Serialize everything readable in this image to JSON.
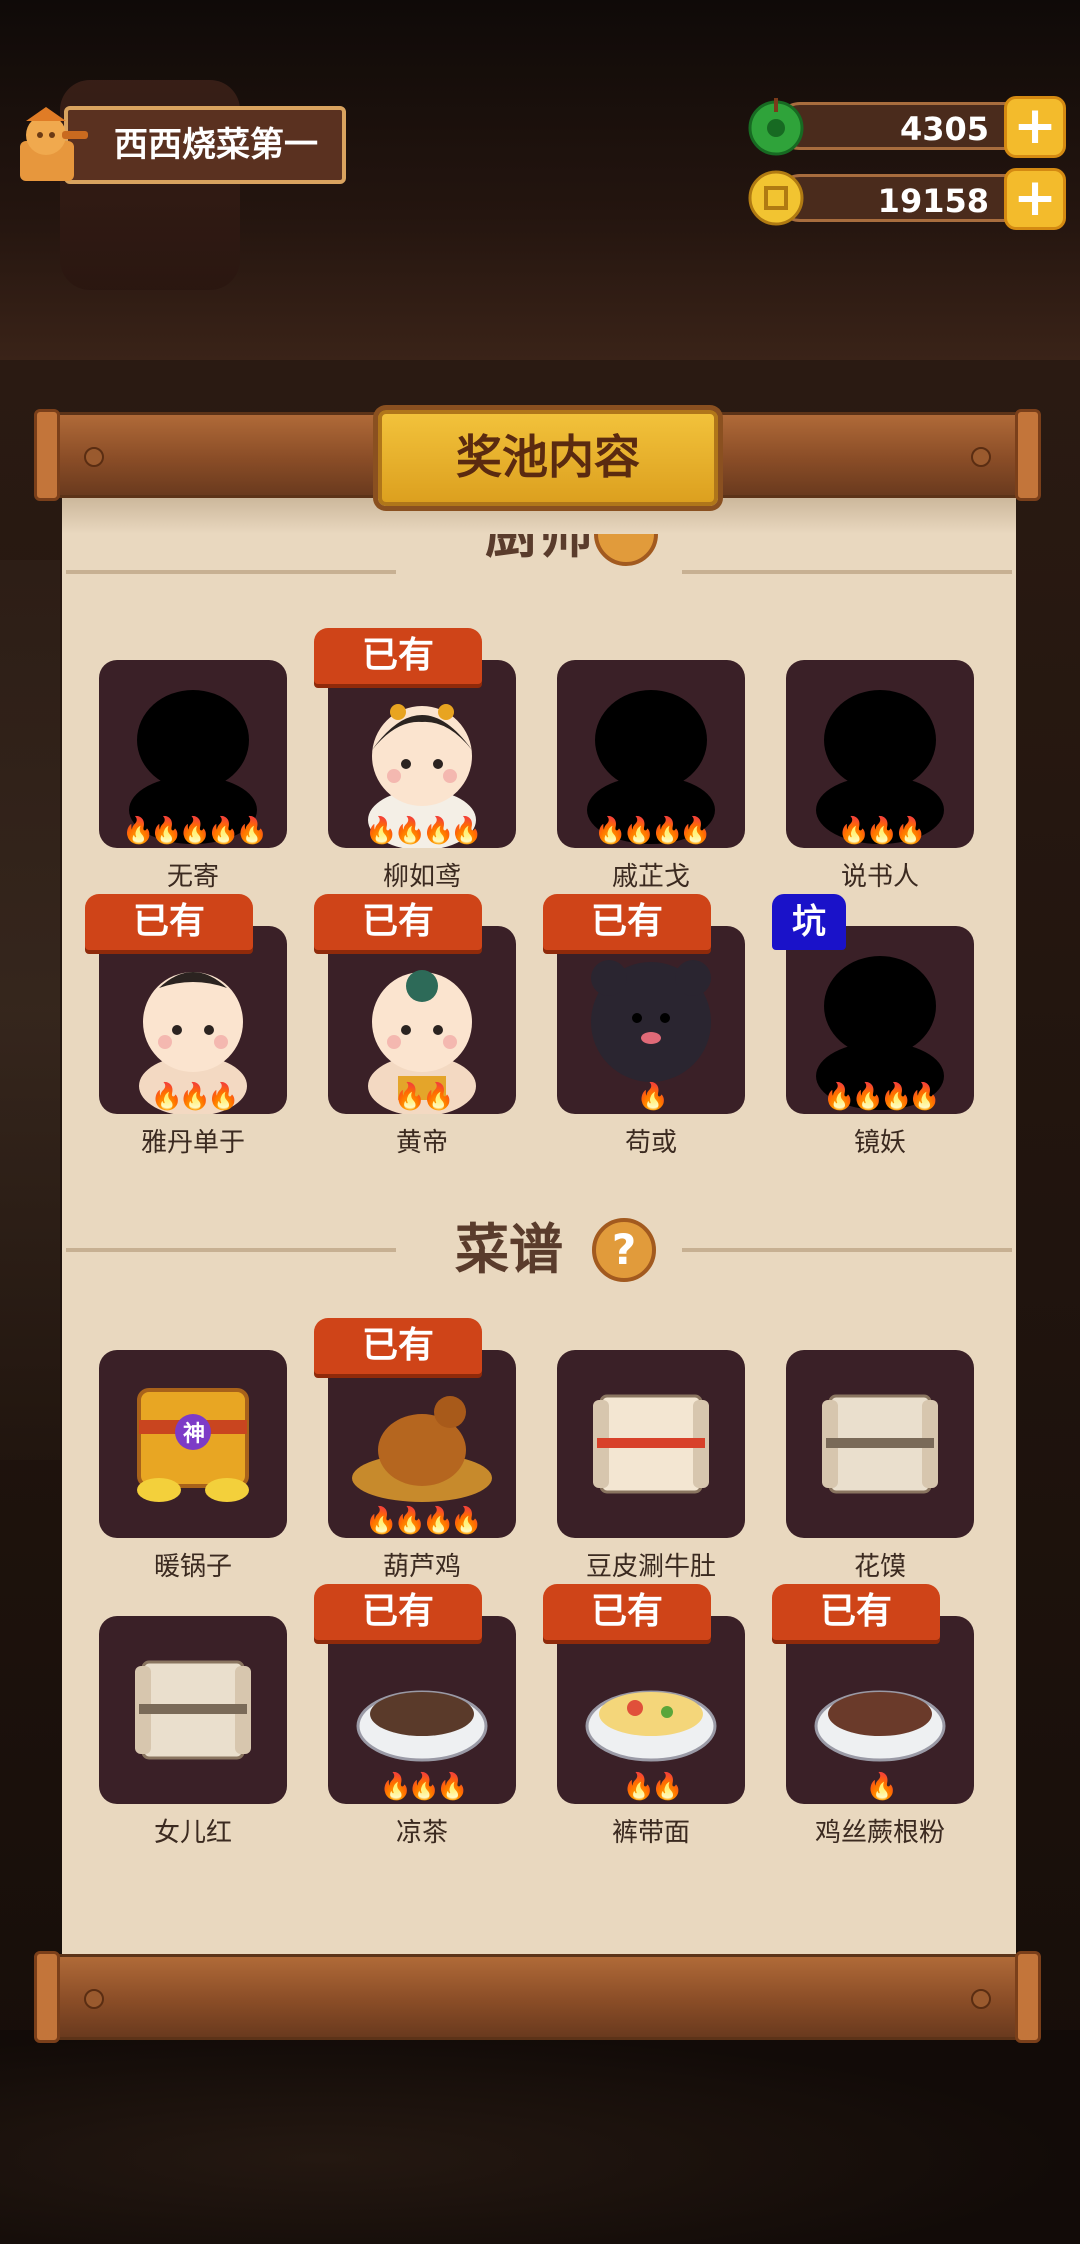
{
  "player": {
    "name": "西西烧菜第一",
    "avatar_icon": "chef-avatar-icon"
  },
  "currencies": [
    {
      "icon": "jade-coin-icon",
      "value": "4305"
    },
    {
      "icon": "copper-coin-icon",
      "value": "19158"
    }
  ],
  "panel": {
    "title": "奖池内容"
  },
  "sections": {
    "chefs": {
      "title": "厨师",
      "help": "?"
    },
    "recipes": {
      "title": "菜谱",
      "help": "?"
    }
  },
  "badges": {
    "owned": "已有",
    "pit": "坑"
  },
  "chefs": [
    {
      "name": "无寄",
      "fires": 5,
      "owned": false,
      "revealed": false
    },
    {
      "name": "柳如鸢",
      "fires": 4,
      "owned": true,
      "revealed": true
    },
    {
      "name": "戚芷戈",
      "fires": 4,
      "owned": false,
      "revealed": false
    },
    {
      "name": "说书人",
      "fires": 3,
      "owned": false,
      "revealed": false
    },
    {
      "name": "雅丹单于",
      "fires": 3,
      "owned": true,
      "revealed": true
    },
    {
      "name": "黄帝",
      "fires": 2,
      "owned": true,
      "revealed": true
    },
    {
      "name": "苟或",
      "fires": 1,
      "owned": true,
      "revealed": true
    },
    {
      "name": "镜妖",
      "fires": 4,
      "owned": false,
      "revealed": false,
      "pit": true
    }
  ],
  "recipes": [
    {
      "name": "暖锅子",
      "fires": 0,
      "owned": false,
      "icon": "golden-treasure-chest-icon",
      "tag": "神"
    },
    {
      "name": "葫芦鸡",
      "fires": 4,
      "owned": true,
      "icon": "roast-chicken-icon"
    },
    {
      "name": "豆皮涮牛肚",
      "fires": 0,
      "owned": false,
      "icon": "red-scroll-icon"
    },
    {
      "name": "花馍",
      "fires": 0,
      "owned": false,
      "icon": "paper-scroll-icon"
    },
    {
      "name": "女儿红",
      "fires": 0,
      "owned": false,
      "icon": "paper-scroll-icon"
    },
    {
      "name": "凉茶",
      "fires": 3,
      "owned": true,
      "icon": "tea-bowl-icon"
    },
    {
      "name": "裤带面",
      "fires": 2,
      "owned": true,
      "icon": "noodle-bowl-icon"
    },
    {
      "name": "鸡丝蕨根粉",
      "fires": 1,
      "owned": true,
      "icon": "meat-bowl-icon"
    }
  ],
  "colors": {
    "owned_badge": "#cf4418",
    "pit_badge": "#1a12c9",
    "card_bg": "#3a2027",
    "paper": "#e9d8bf"
  }
}
